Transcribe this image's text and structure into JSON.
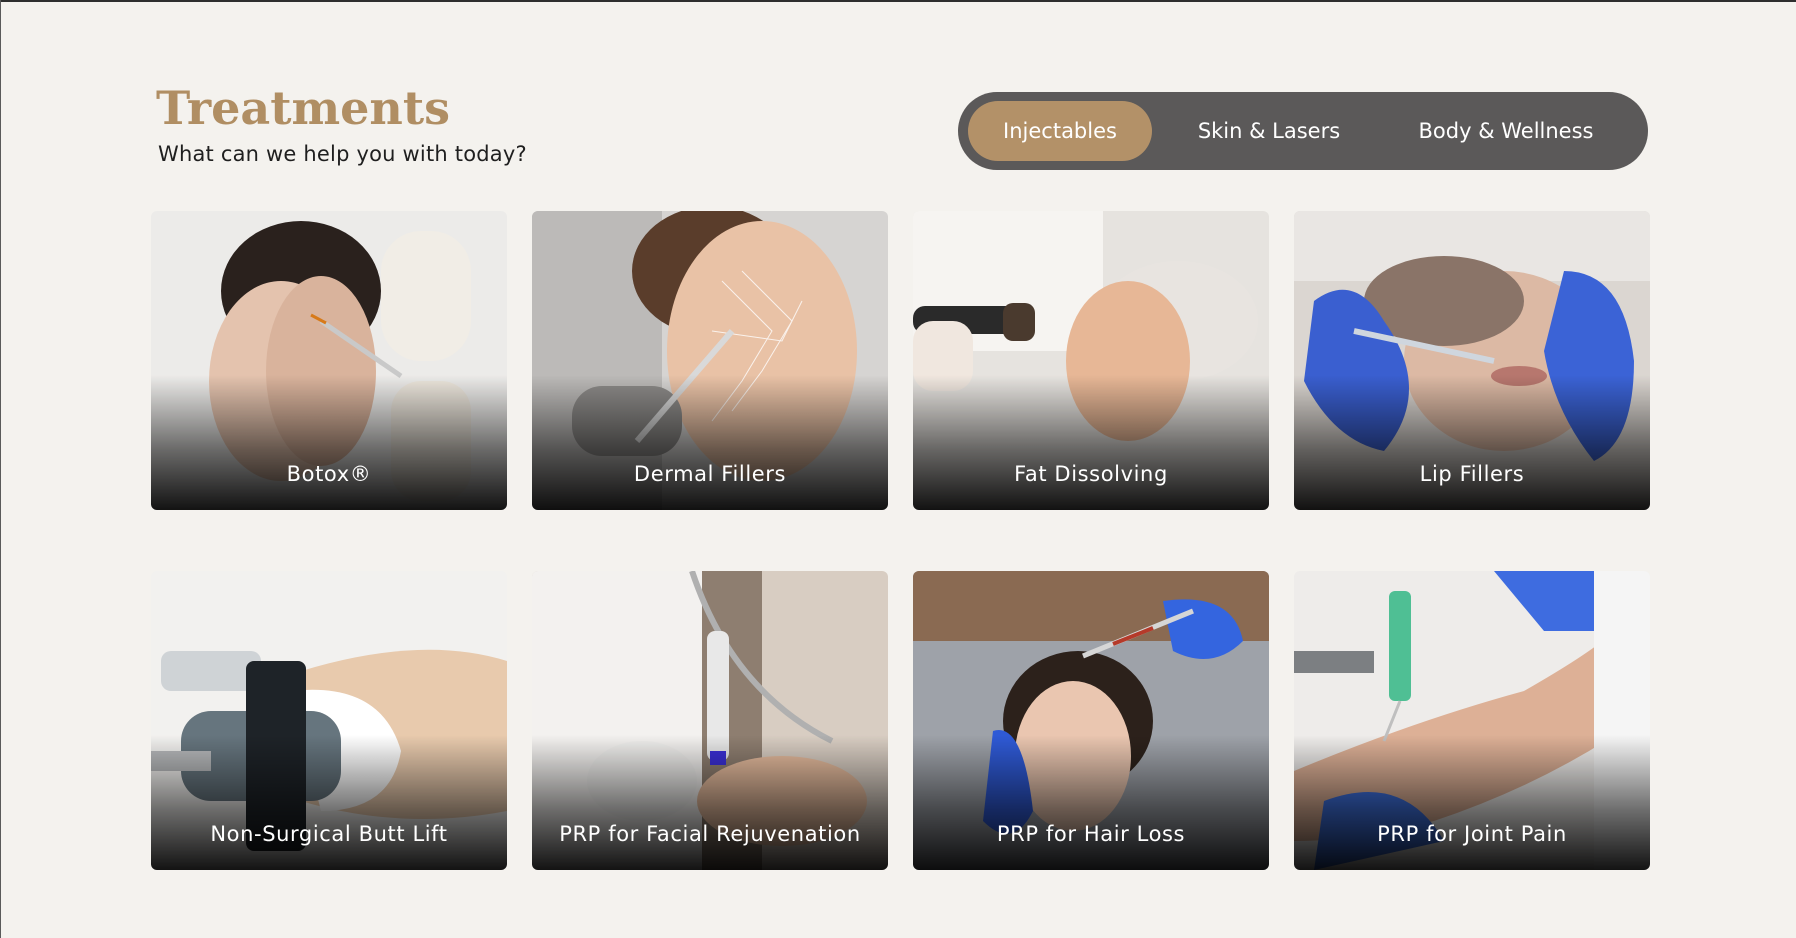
{
  "header": {
    "title": "Treatments",
    "subtitle": "What can we help you with today?"
  },
  "tabs": [
    {
      "label": "Injectables",
      "active": true
    },
    {
      "label": "Skin & Lasers",
      "active": false
    },
    {
      "label": "Body & Wellness",
      "active": false
    }
  ],
  "treatments": [
    {
      "label": "Botox®"
    },
    {
      "label": "Dermal Fillers"
    },
    {
      "label": "Fat Dissolving"
    },
    {
      "label": "Lip Fillers"
    },
    {
      "label": "Non-Surgical Butt Lift"
    },
    {
      "label": "PRP for Facial Rejuvenation"
    },
    {
      "label": "PRP for Hair Loss"
    },
    {
      "label": "PRP for Joint Pain"
    }
  ],
  "colors": {
    "background": "#f4f2ee",
    "accent": "#b08e63",
    "tab_track": "#5b5959",
    "tab_active": "#b39168"
  }
}
